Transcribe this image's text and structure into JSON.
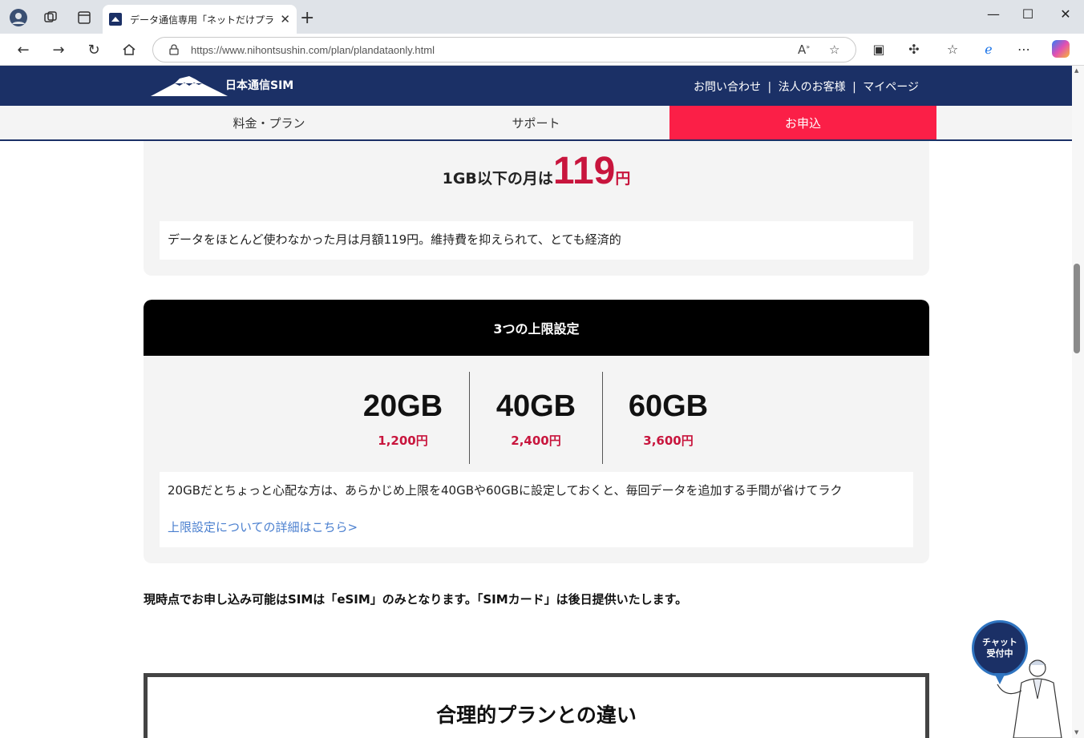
{
  "browser": {
    "tab_title": "データ通信専用「ネットだけプラン」| E",
    "url": "https://www.nihontsushin.com/plan/plandataonly.html",
    "tab_close": "✕",
    "new_tab": "+"
  },
  "site": {
    "logo_text": "日本通信SIM",
    "header_links": [
      "お問い合わせ",
      "|",
      "法人のお客様",
      "|",
      "マイページ"
    ],
    "nav": [
      "料金・プラン",
      "サポート",
      "お申込"
    ]
  },
  "low_usage": {
    "prefix": "1GB以下の月は",
    "price": "119",
    "unit": "円",
    "description": "データをほとんど使わなかった月は月額119円。維持費を抑えられて、とても経済的"
  },
  "caps": {
    "title": "3つの上限設定",
    "options": [
      {
        "size": "20GB",
        "price": "1,200円"
      },
      {
        "size": "40GB",
        "price": "2,400円"
      },
      {
        "size": "60GB",
        "price": "3,600円"
      }
    ],
    "description": "20GBだとちょっと心配な方は、あらかじめ上限を40GBや60GBに設定しておくと、毎回データを追加する手間が省けてラク",
    "detail_link": "上限設定についての詳細はこちら>"
  },
  "notice": "現時点でお申し込み可能はSIMは「eSIM」のみとなります。「SIMカード」は後日提供いたします。",
  "comparison_title": "合理的プランとの違い",
  "chat": {
    "line1": "チャット",
    "line2": "受付中"
  }
}
